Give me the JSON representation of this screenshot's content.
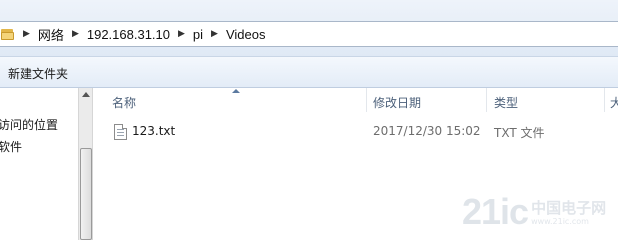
{
  "address_bar": {
    "crumbs": [
      "网络",
      "192.168.31.10",
      "pi",
      "Videos"
    ]
  },
  "toolbar": {
    "new_folder_label": "新建文件夹"
  },
  "nav_pane": {
    "items": [
      "访问的位置",
      "软件"
    ]
  },
  "file_list": {
    "columns": [
      "名称",
      "修改日期",
      "类型",
      "大"
    ],
    "rows": [
      {
        "name": "123.txt",
        "modified": "2017/12/30 15:02",
        "type": "TXT 文件"
      }
    ]
  },
  "watermark": {
    "big": "21ic",
    "cn": "中国电子网",
    "url": "www.21ic.com"
  },
  "colors": {
    "header_text": "#4c607a",
    "folder": "#e2b64a",
    "toolbar_bg": "#e3ecf7"
  }
}
